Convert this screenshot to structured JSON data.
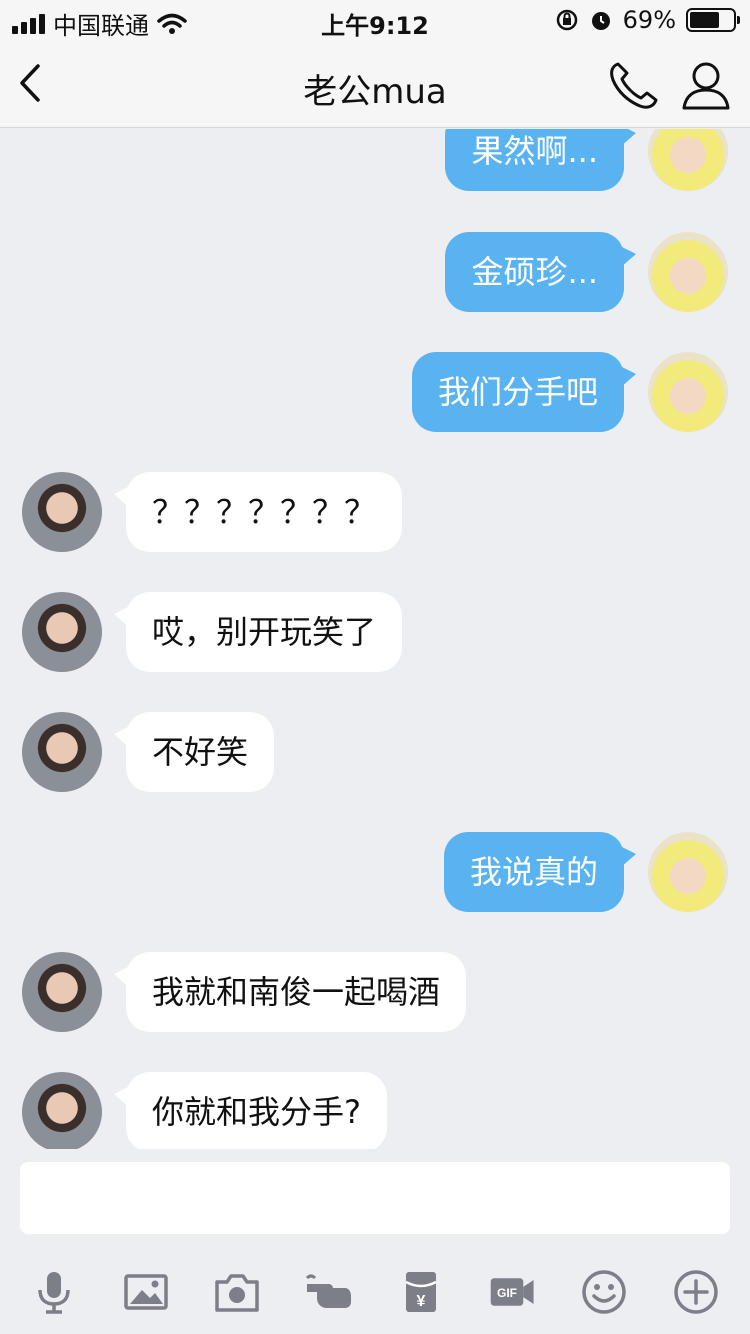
{
  "status": {
    "carrier": "中国联通",
    "time": "上午9:12",
    "battery": "69%",
    "battery_level": 0.69
  },
  "nav": {
    "title": "老公mua",
    "icons": [
      "back-icon",
      "phone-icon",
      "profile-icon"
    ]
  },
  "messages": [
    {
      "from": "me",
      "text": "果然啊..."
    },
    {
      "from": "me",
      "text": "金硕珍..."
    },
    {
      "from": "me",
      "text": "我们分手吧"
    },
    {
      "from": "other",
      "text": "？？？？？？？"
    },
    {
      "from": "other",
      "text": "哎，别开玩笑了"
    },
    {
      "from": "other",
      "text": "不好笑"
    },
    {
      "from": "me",
      "text": "我说真的"
    },
    {
      "from": "other",
      "text": "我就和南俊一起喝酒"
    },
    {
      "from": "other",
      "text": "你就和我分手?"
    }
  ],
  "input": {
    "value": "",
    "placeholder": ""
  },
  "toolbar": {
    "icons": [
      "microphone-icon",
      "image-icon",
      "camera-icon",
      "poke-hand-icon",
      "red-packet-icon",
      "gif-icon",
      "emoji-icon",
      "plus-icon"
    ]
  },
  "colors": {
    "my_bubble": "#59b3f0",
    "other_bubble": "#ffffff",
    "background": "#eceef2",
    "icon_gray": "#7c7e88"
  }
}
